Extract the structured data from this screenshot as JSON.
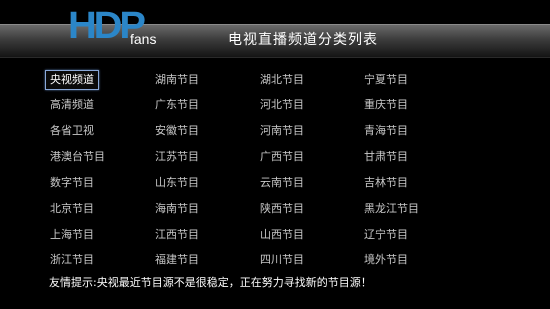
{
  "header": {
    "logo_main": "HDP",
    "logo_sub": "fans",
    "title": "电视直播频道分类列表"
  },
  "categories": [
    [
      "央视频道",
      "湖南节目",
      "湖北节目",
      "宁夏节目"
    ],
    [
      "高清频道",
      "广东节目",
      "河北节目",
      "重庆节目"
    ],
    [
      "各省卫视",
      "安徽节目",
      "河南节目",
      "青海节目"
    ],
    [
      "港澳台节目",
      "江苏节目",
      "广西节目",
      "甘肃节目"
    ],
    [
      "数字节目",
      "山东节目",
      "云南节目",
      "吉林节目"
    ],
    [
      "北京节目",
      "海南节目",
      "陕西节目",
      "黑龙江节目"
    ],
    [
      "上海节目",
      "江西节目",
      "山西节目",
      "辽宁节目"
    ],
    [
      "浙江节目",
      "福建节目",
      "四川节目",
      "境外节目"
    ]
  ],
  "selected": "央视频道",
  "notice": "友情提示:央视最近节目源不是很稳定，正在努力寻找新的节目源！"
}
